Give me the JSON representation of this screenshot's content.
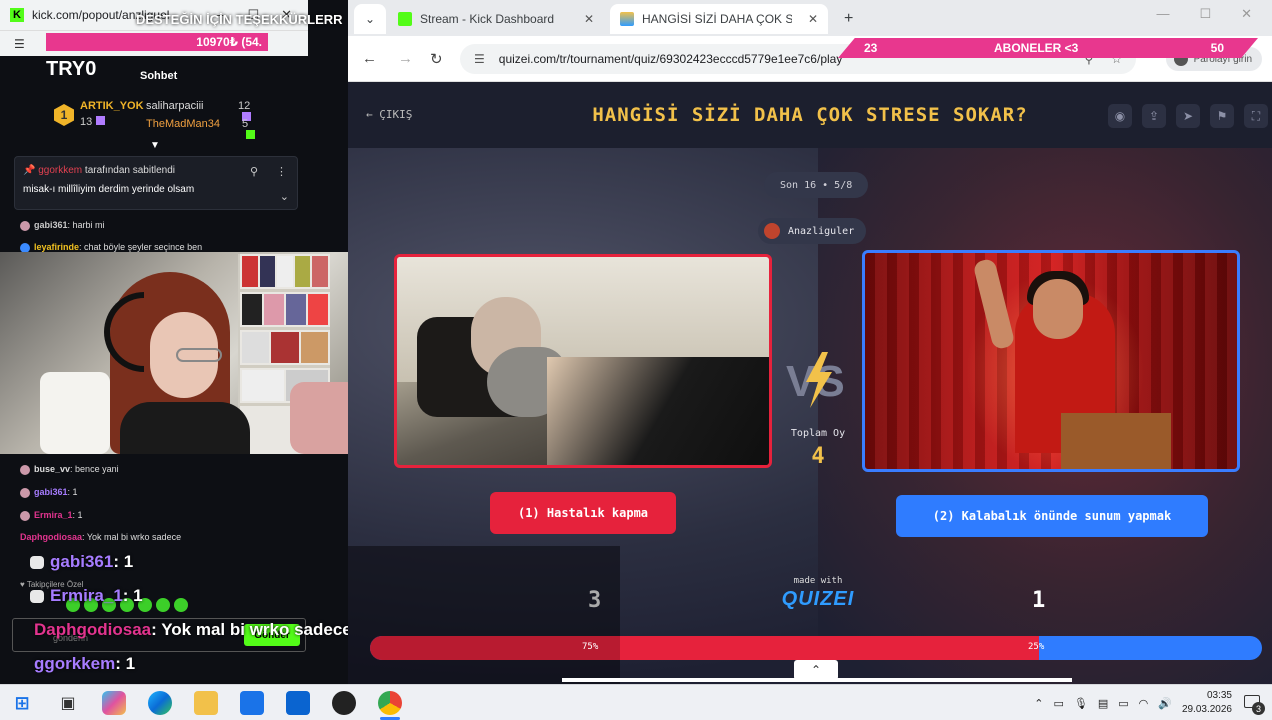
{
  "left_popout": {
    "url": "kick.com/popout/anzliguel",
    "window_controls": [
      "—",
      "☐",
      "✕"
    ],
    "thanks_overlay": "DESTEĞİN İÇİN TEŞEKKÜRLERR",
    "goal_text": "10970₺ (54.",
    "channel_name": "TRY0",
    "chat_tab": "Sohbet",
    "leaderboard": {
      "first": {
        "rank": "1",
        "name": "ARTIK_YOK",
        "count": "13"
      },
      "rows": [
        {
          "name": "saliharpaciii",
          "count": "12"
        },
        {
          "name": "TheMadMan34",
          "count": "5"
        }
      ]
    },
    "pinned": {
      "by_user": "ggorkkem",
      "by_text": "tarafından sabitlendi",
      "message": "misak-ı millîliyim derdim yerinde olsam"
    },
    "chat_small": [
      {
        "user": "gabi361",
        "text": "harbi mi"
      },
      {
        "user": "leyafirinde",
        "text": "chat böyle şeyler seçince ben"
      },
      {
        "user": "buse_vv",
        "text": "bence yani"
      },
      {
        "user": "gabi361",
        "text": "1"
      },
      {
        "user": "Ermira_1",
        "text": "1"
      },
      {
        "user": "Daphgodiosaa",
        "text": "Yok mal bi wrko sadece"
      }
    ],
    "chat_big": [
      {
        "user": "gabi361",
        "text": ": 1"
      },
      {
        "user": "Ermira_1",
        "text": ": 1"
      },
      {
        "user": "Daphgodiosaa",
        "text": ": Yok mal bi wrko sadece"
      },
      {
        "user": "ggorkkem",
        "text": ": 1"
      }
    ],
    "followers_label": "Takipçilere Özel",
    "send_label": "Gönder",
    "send_label_faint": "gönderin"
  },
  "browser": {
    "tabs": [
      {
        "title": "Stream - Kick Dashboard",
        "active": false
      },
      {
        "title": "HANGİSİ SİZİ DAHA ÇOK STRES",
        "active": true
      }
    ],
    "new_tab": "+",
    "url": "quizei.com/tr/tournament/quiz/69302423ecccd5779e1ee7c6/play",
    "password_chip": "Parolayı girin",
    "sub_goal": {
      "left": "23",
      "center": "ABONELER <3",
      "right": "50"
    }
  },
  "quiz": {
    "exit_label": "ÇIKIŞ",
    "title": "HANGİSİ SİZİ DAHA ÇOK STRESE SOKAR?",
    "round": "Son 16 • 5/8",
    "author": "Anazliguler",
    "vs_label": "VS",
    "total_label": "Toplam Oy",
    "total_votes": "4",
    "options": [
      {
        "label": "(1) Hastalık kapma",
        "votes": "3",
        "percent": "75%",
        "share": 0.75,
        "color": "#e6223c"
      },
      {
        "label": "(2) Kalabalık önünde sunum yapmak",
        "votes": "1",
        "percent": "25%",
        "share": 0.25,
        "color": "#2f7cff"
      }
    ],
    "made_with": "made with",
    "brand": "QUIZEI"
  },
  "taskbar": {
    "time": "03:35",
    "date": "29.03.2026",
    "notifications": "3"
  }
}
